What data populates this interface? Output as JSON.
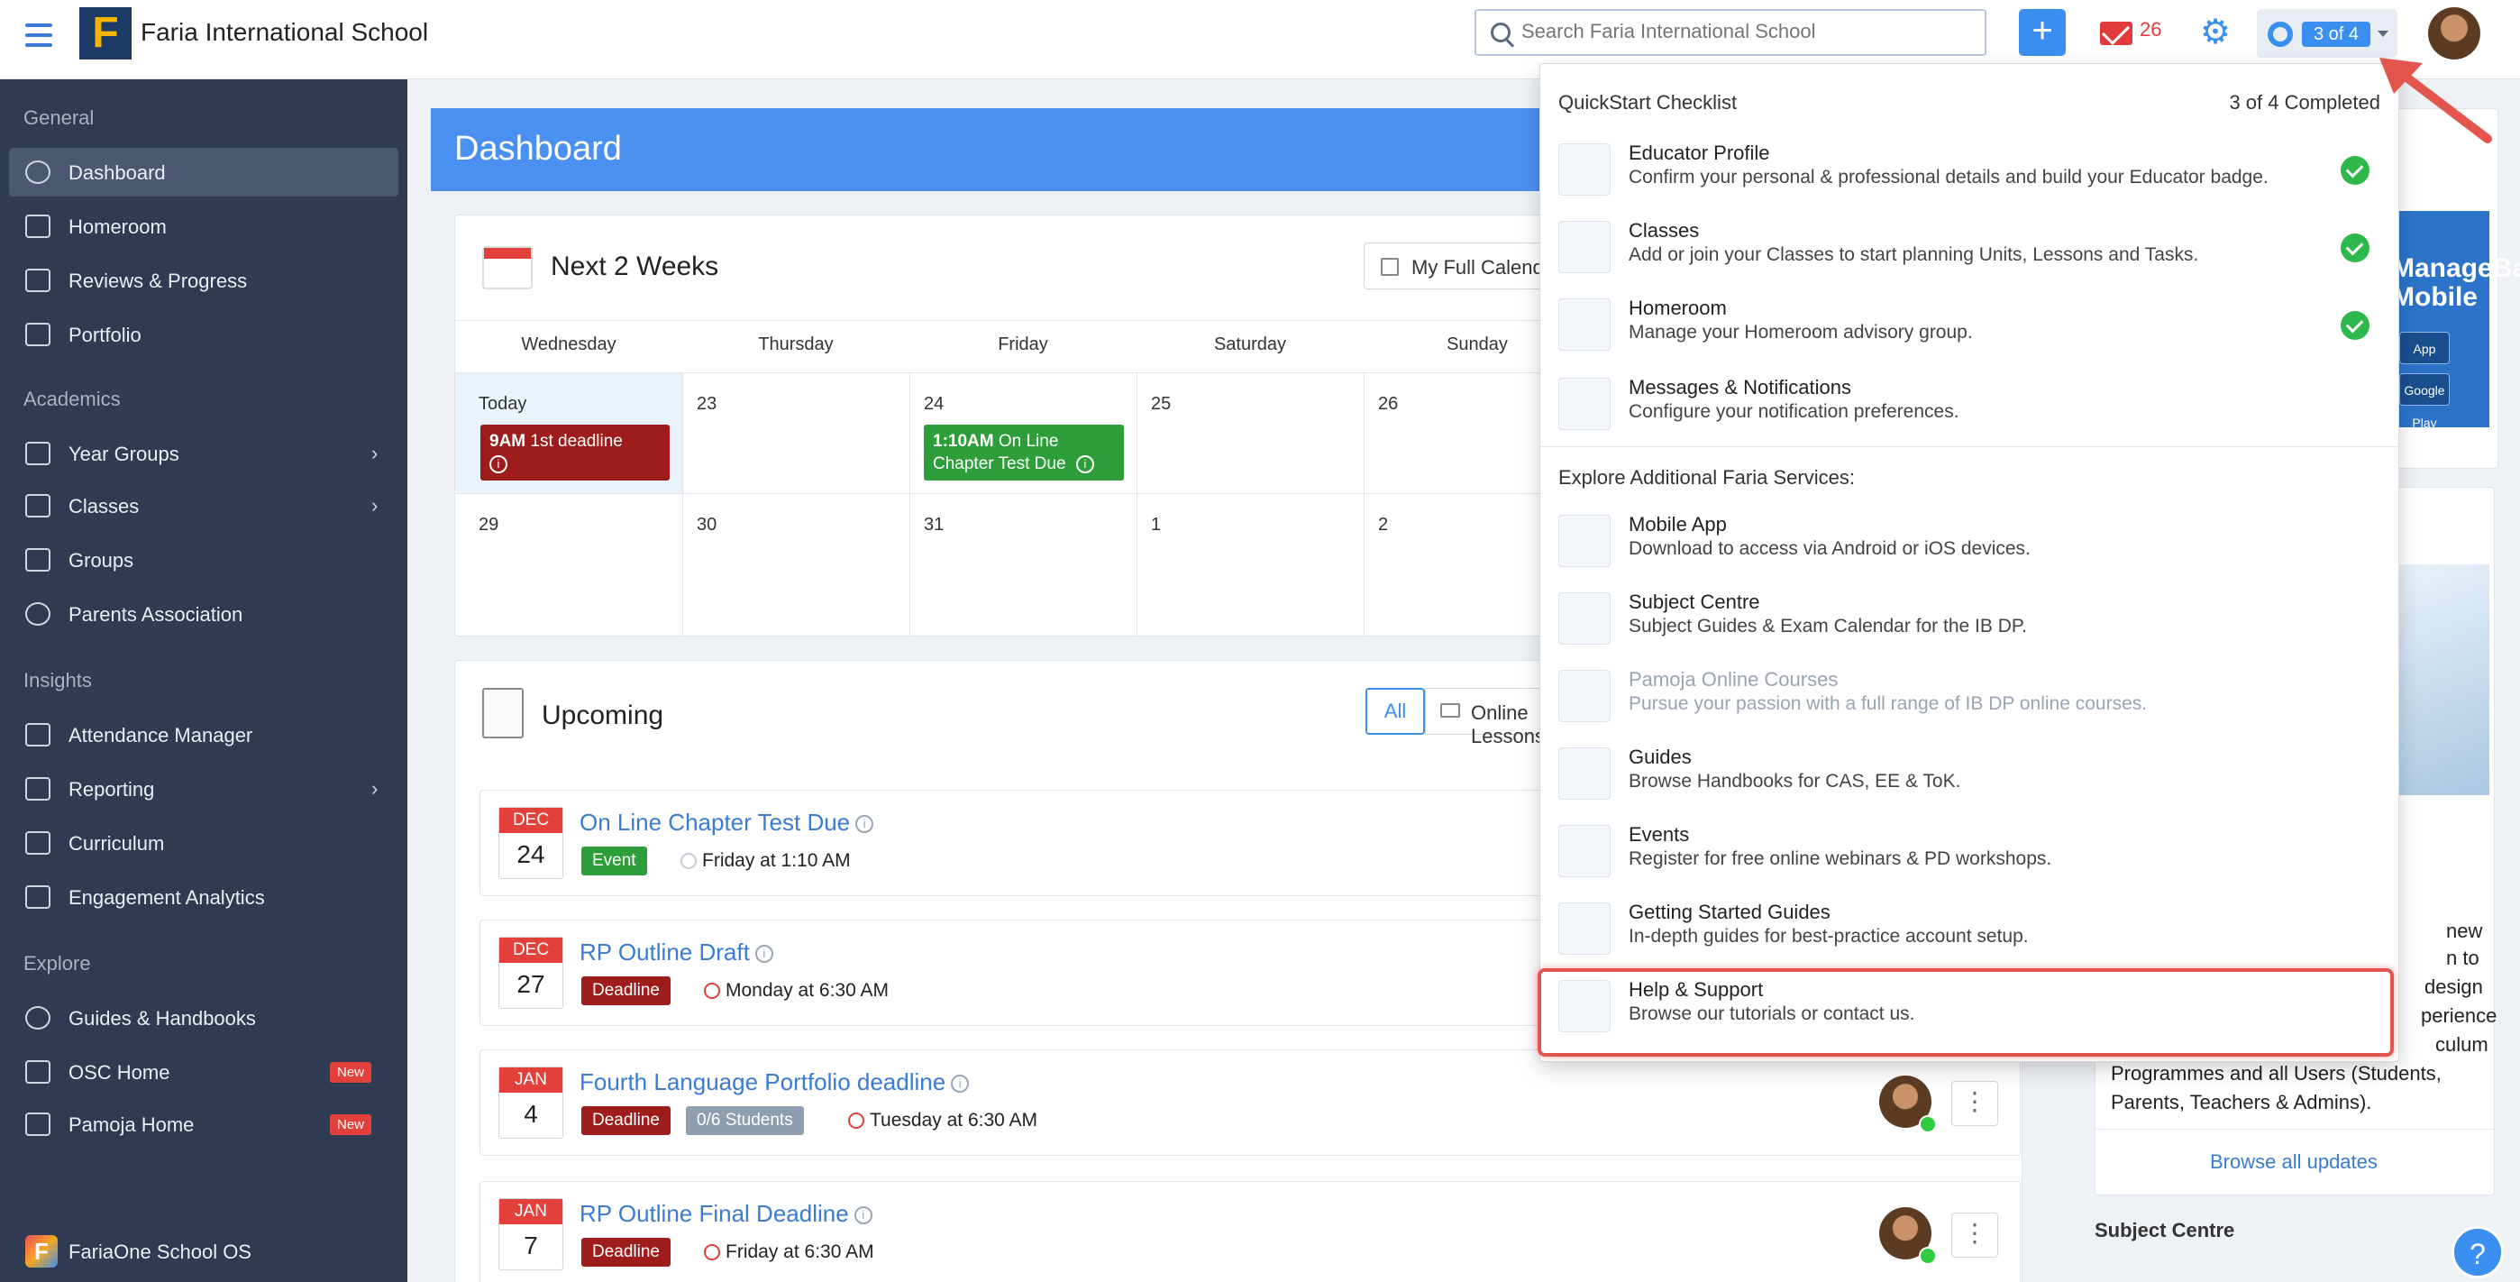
{
  "header": {
    "school_name": "Faria International School",
    "logo_letter": "F",
    "search_placeholder": "Search Faria International School",
    "add_label": "+",
    "mail_count": "26",
    "quickstart_badge": "3 of 4"
  },
  "sidebar": {
    "sections": [
      {
        "title": "General",
        "items": [
          "Dashboard",
          "Homeroom",
          "Reviews & Progress",
          "Portfolio"
        ]
      },
      {
        "title": "Academics",
        "items": [
          "Year Groups",
          "Classes",
          "Groups",
          "Parents Association"
        ]
      },
      {
        "title": "Insights",
        "items": [
          "Attendance Manager",
          "Reporting",
          "Curriculum",
          "Engagement Analytics"
        ]
      },
      {
        "title": "Explore",
        "items": [
          "Guides & Handbooks",
          "OSC Home",
          "Pamoja Home"
        ]
      }
    ],
    "new_badge": "New",
    "footer": "FariaOne School OS"
  },
  "dashboard": {
    "title": "Dashboard",
    "calendar": {
      "title": "Next 2 Weeks",
      "full_calendar_btn": "My Full Calendar",
      "days": [
        "Wednesday",
        "Thursday",
        "Friday",
        "Saturday",
        "Sunday"
      ],
      "week1": [
        "Today",
        "23",
        "24",
        "25",
        "26"
      ],
      "week2": [
        "29",
        "30",
        "31",
        "1",
        "2"
      ],
      "events": [
        {
          "time": "9AM",
          "title": "1st deadline"
        },
        {
          "time": "1:10AM",
          "title": "On Line Chapter Test Due"
        }
      ]
    },
    "upcoming": {
      "title": "Upcoming",
      "filter_all": "All",
      "filter_online": "Online Lessons",
      "items": [
        {
          "month": "DEC",
          "day": "24",
          "title": "On Line Chapter Test Due",
          "tag": "Event",
          "when": "Friday at 1:10 AM"
        },
        {
          "month": "DEC",
          "day": "27",
          "title": "RP Outline Draft",
          "tag": "Deadline",
          "when": "Monday at 6:30 AM"
        },
        {
          "month": "JAN",
          "day": "4",
          "title": "Fourth Language Portfolio deadline",
          "tag": "Deadline",
          "students": "0/6 Students",
          "when": "Tuesday at 6:30 AM"
        },
        {
          "month": "JAN",
          "day": "7",
          "title": "RP Outline Final Deadline",
          "tag": "Deadline",
          "when": "Friday at 6:30 AM"
        }
      ]
    }
  },
  "right": {
    "mobile_banner": "ManageBac Mobile",
    "app_store": "App Store",
    "google_play": "Google Play",
    "update_lines": [
      "new",
      "n to",
      "design",
      "perience",
      "culum",
      "Programmes and all Users (Students,",
      "Parents, Teachers & Admins)."
    ],
    "browse_all": "Browse all updates",
    "subject_centre": "Subject Centre"
  },
  "quickstart": {
    "title": "QuickStart Checklist",
    "completed": "3 of 4 Completed",
    "checklist": [
      {
        "title": "Educator Profile",
        "desc": "Confirm your personal & professional details and build your Educator badge.",
        "done": true
      },
      {
        "title": "Classes",
        "desc": "Add or join your Classes to start planning Units, Lessons and Tasks.",
        "done": true
      },
      {
        "title": "Homeroom",
        "desc": "Manage your Homeroom advisory group.",
        "done": true
      },
      {
        "title": "Messages & Notifications",
        "desc": "Configure your notification preferences.",
        "done": false
      }
    ],
    "explore_title": "Explore Additional Faria Services:",
    "services": [
      {
        "title": "Mobile App",
        "desc": "Download to access via Android or iOS devices."
      },
      {
        "title": "Subject Centre",
        "desc": "Subject Guides & Exam Calendar for the IB DP."
      },
      {
        "title": "Pamoja Online Courses",
        "desc": "Pursue your passion with a full range of IB DP online courses."
      },
      {
        "title": "Guides",
        "desc": "Browse Handbooks for CAS, EE & ToK."
      },
      {
        "title": "Events",
        "desc": "Register for free online webinars & PD workshops."
      },
      {
        "title": "Getting Started Guides",
        "desc": "In-depth guides for best-practice account setup."
      },
      {
        "title": "Help & Support",
        "desc": "Browse our tutorials or contact us."
      }
    ]
  },
  "colors": {
    "accent": "#3a8ff0",
    "sidebar": "#2e3b52",
    "deadline": "#9e1c1c",
    "event": "#2e9e3a",
    "highlight": "#e4564d"
  }
}
